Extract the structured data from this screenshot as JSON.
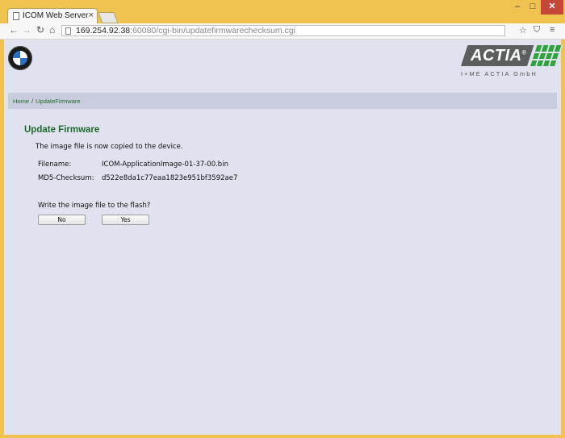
{
  "browser": {
    "tab_title": "ICOM Web Server - ",
    "tab_close": "×",
    "url_host": "169.254.92.38",
    "url_rest": ":60080/cgi-bin/updatefirmwarechecksum.cgi",
    "win_min": "–",
    "win_max": "□",
    "win_close": "✕",
    "back": "←",
    "forward": "→",
    "reload": "↻",
    "home": "⌂",
    "menu": "≡",
    "star": "☆"
  },
  "header": {
    "actia_brand": "ACTIA",
    "actia_reg": "®",
    "actia_subtitle": "I+ME ACTIA GmbH"
  },
  "breadcrumb": {
    "home": "Home",
    "separator": "/",
    "current": "UpdateFirmware"
  },
  "main": {
    "title": "Update Firmware",
    "status_message": "The image file is now copied to the device.",
    "filename_label": "Filename:",
    "filename_value": "ICOM-ApplicationImage-01-37-00.bin",
    "checksum_label": "MD5-Checksum:",
    "checksum_value": "d522e8da1c77eaa1823e951bf3592ae7",
    "question": "Write the image file to the flash?",
    "no_label": "No",
    "yes_label": "Yes"
  }
}
